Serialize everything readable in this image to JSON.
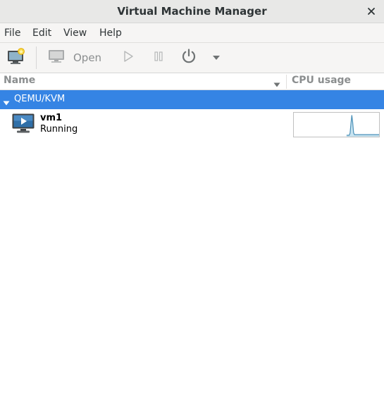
{
  "window": {
    "title": "Virtual Machine Manager",
    "close_icon": "close-icon"
  },
  "menubar": {
    "items": [
      {
        "label": "File"
      },
      {
        "label": "Edit"
      },
      {
        "label": "View"
      },
      {
        "label": "Help"
      }
    ]
  },
  "toolbar": {
    "new_vm_icon": "new-vm-icon",
    "open_icon": "monitor-icon",
    "open_label": "Open",
    "run_icon": "play-icon",
    "pause_icon": "pause-icon",
    "shutdown_icon": "power-icon",
    "shutdown_menu_icon": "chevron-down-icon"
  },
  "list": {
    "columns": {
      "name": "Name",
      "cpu": "CPU usage"
    },
    "connections": [
      {
        "label": "QEMU/KVM",
        "expanded": true,
        "vms": [
          {
            "name": "vm1",
            "status": "Running",
            "cpu_history": [
              0,
              0,
              0,
              0,
              0,
              0,
              0,
              0,
              0,
              0,
              0,
              0,
              0,
              0,
              0,
              0,
              0,
              0,
              0,
              0,
              0,
              0,
              0,
              0,
              0,
              0,
              0,
              0,
              0,
              0,
              0,
              0,
              0,
              0,
              0,
              0,
              0,
              0,
              0,
              0,
              0,
              0,
              0,
              0,
              0,
              0,
              0,
              0,
              0,
              0,
              0,
              0,
              0,
              0,
              0,
              0,
              0,
              0,
              0,
              0,
              0,
              0,
              0,
              0,
              0.1,
              0.55,
              0.95,
              0.6,
              0.12,
              0.03,
              0.03,
              0.03,
              0.03,
              0.03,
              0.03,
              0.03,
              0.03,
              0.03,
              0.03,
              0.03,
              0.03,
              0.03,
              0.03,
              0.03,
              0.03,
              0.03,
              0.03,
              0.03,
              0.03,
              0.03,
              0.03,
              0.03,
              0.03,
              0.03,
              0.03,
              0.03,
              0.03,
              0.03
            ]
          }
        ]
      }
    ]
  },
  "colors": {
    "selection": "#3584e4",
    "graph_line": "#4a90b8",
    "graph_fill": "#c7e3f0"
  }
}
